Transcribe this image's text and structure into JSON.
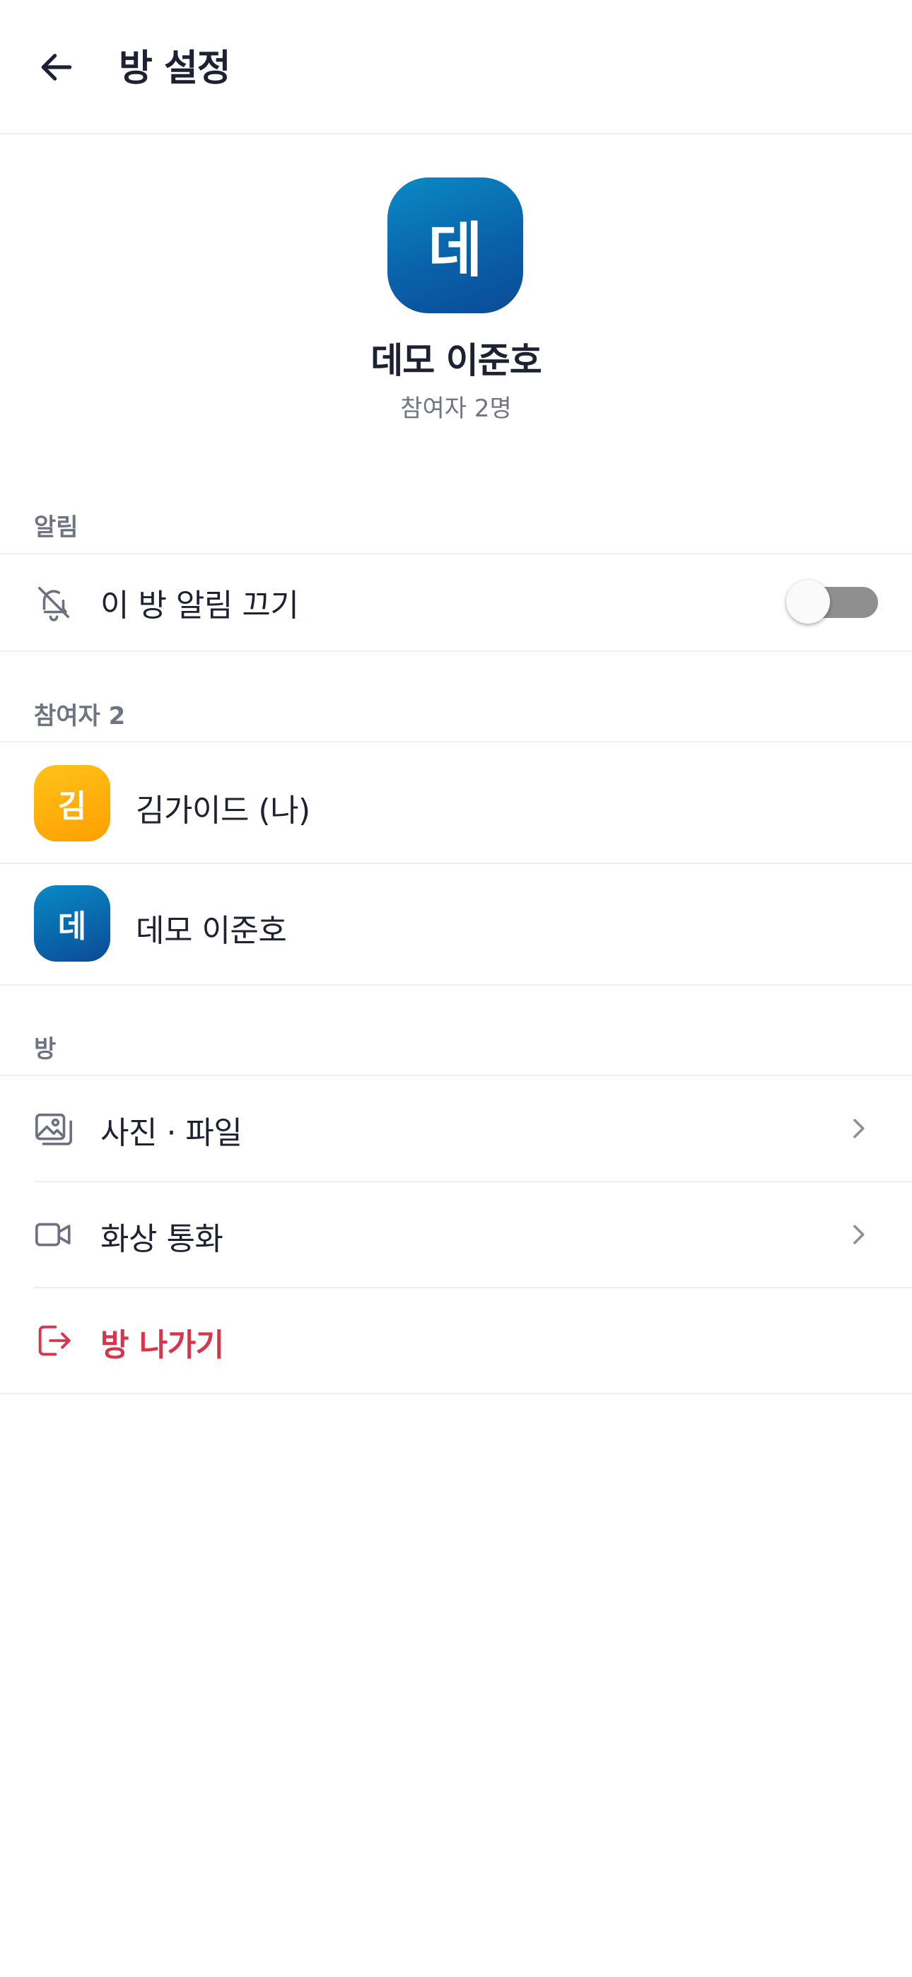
{
  "header": {
    "title": "방 설정",
    "back_icon": "arrow-left-icon"
  },
  "room": {
    "avatar_letter": "데",
    "name": "데모 이준호",
    "participant_summary": "참여자 2명",
    "avatar_color": "#0a6fb5"
  },
  "notifications": {
    "section_label": "알림",
    "mute_label": "이 방 알림 끄기",
    "mute_icon": "bell-off-icon",
    "mute_enabled": false
  },
  "participants": {
    "section_label": "참여자 2",
    "members": [
      {
        "initial": "김",
        "name": "김가이드 (나)",
        "color": "#ffb000"
      },
      {
        "initial": "데",
        "name": "데모 이준호",
        "color": "#0a6fb5"
      }
    ]
  },
  "room_section": {
    "section_label": "방",
    "items": [
      {
        "label": "사진 · 파일",
        "icon": "image-icon"
      },
      {
        "label": "화상 통화",
        "icon": "video-camera-icon"
      }
    ],
    "leave_label": "방 나가기",
    "leave_icon": "exit-icon",
    "leave_color": "#d9344a"
  }
}
